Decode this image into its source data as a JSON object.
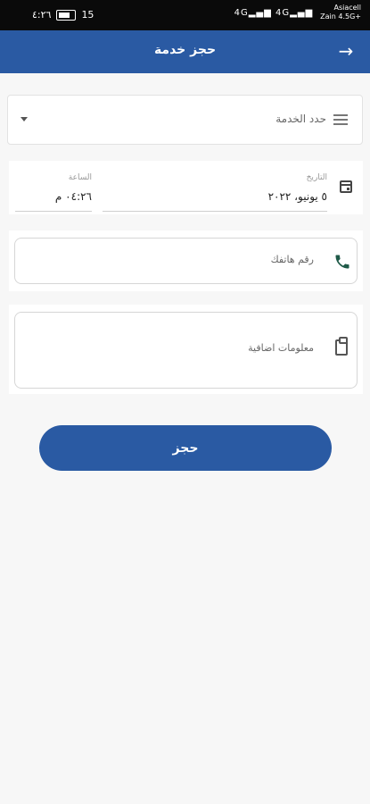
{
  "status_bar": {
    "time": "٤:٢٦",
    "battery": "15",
    "signal_a": "4G",
    "signal_b": "4G",
    "carrier_1": "Asiacell",
    "carrier_2": "Zain 4.5G+"
  },
  "app_bar": {
    "title": "حجز خدمة",
    "back_icon": "arrow-right-icon"
  },
  "service": {
    "label": "حدد الخدمة",
    "icon": "list-icon"
  },
  "date_time": {
    "date_label": "التاريخ",
    "date_value": "٥ يونيو، ٢٠٢٢",
    "time_label": "الساعة",
    "time_value": "٠٤:٢٦ م",
    "icon": "calendar-icon"
  },
  "phone": {
    "placeholder": "رقم هاتفك",
    "icon": "phone-icon"
  },
  "info": {
    "placeholder": "معلومات اضافية",
    "icon": "clipboard-icon"
  },
  "book_button": {
    "label": "حجز"
  },
  "colors": {
    "primary": "#2a5aa3",
    "background": "#f7f7f7",
    "icon_green": "#1f5a48"
  }
}
